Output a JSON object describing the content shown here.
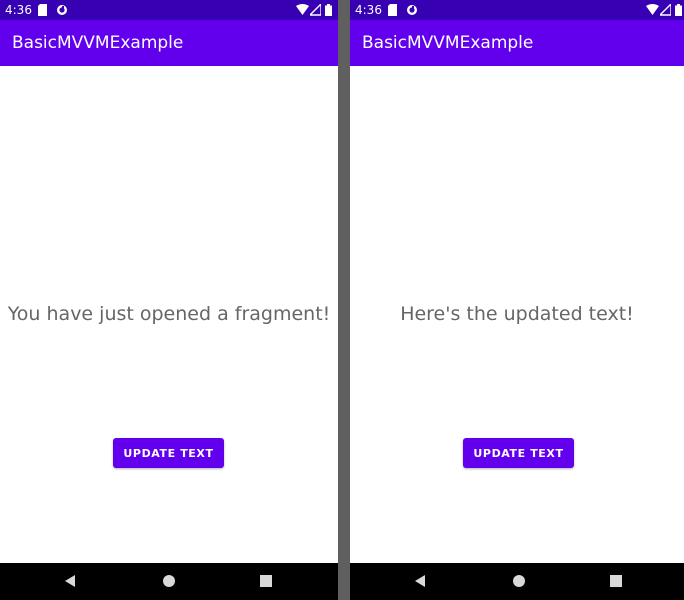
{
  "colors": {
    "status_bar": "#3700b3",
    "app_bar": "#6200ee",
    "button": "#6200ee",
    "divider": "#5f5f5f",
    "text_gray": "#666666",
    "nav_bar": "#000000"
  },
  "screens": [
    {
      "status_bar": {
        "time": "4:36",
        "icons": [
          "sim-card-icon",
          "sync-icon",
          "wifi-icon",
          "signal-icon",
          "battery-icon"
        ]
      },
      "app_bar": {
        "title": "BasicMVVMExample"
      },
      "message": "You have just opened a fragment!",
      "button_label": "UPDATE TEXT",
      "nav": [
        "back-icon",
        "home-icon",
        "recents-icon"
      ]
    },
    {
      "status_bar": {
        "time": "4:36",
        "icons": [
          "sim-card-icon",
          "sync-icon",
          "wifi-icon",
          "signal-icon",
          "battery-icon"
        ]
      },
      "app_bar": {
        "title": "BasicMVVMExample"
      },
      "message": "Here's the updated text!",
      "button_label": "UPDATE TEXT",
      "nav": [
        "back-icon",
        "home-icon",
        "recents-icon"
      ]
    }
  ]
}
